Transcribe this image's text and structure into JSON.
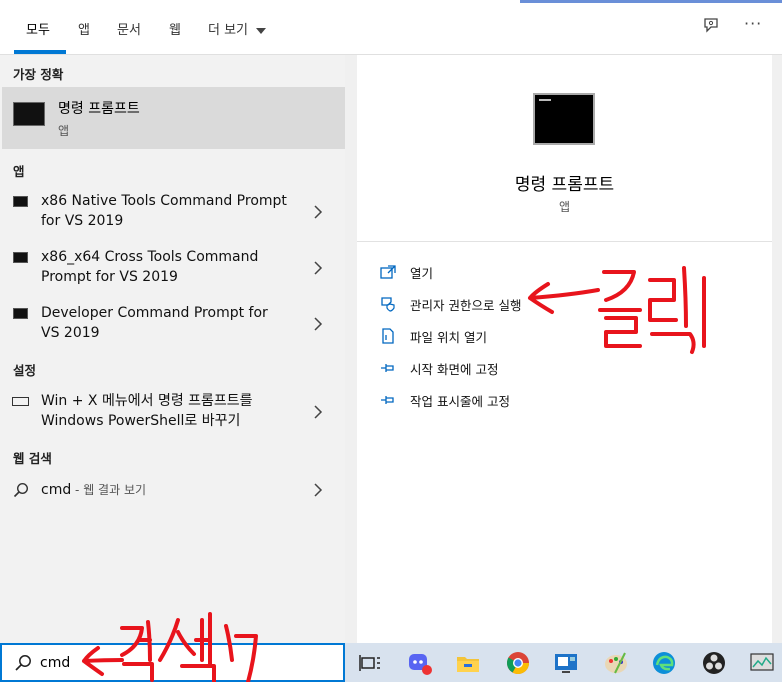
{
  "tabs": [
    {
      "label": "모두"
    },
    {
      "label": "앱"
    },
    {
      "label": "문서"
    },
    {
      "label": "웹"
    },
    {
      "label": "더 보기"
    }
  ],
  "sections": {
    "best_match": "가장 정확",
    "apps": "앱",
    "settings": "설정",
    "web": "웹 검색"
  },
  "best_match": {
    "title": "명령 프롬프트",
    "subtitle": "앱"
  },
  "apps": [
    {
      "line1": "x86 Native Tools Command Prompt",
      "line2": "for VS 2019"
    },
    {
      "line1": "x86_x64 Cross Tools Command",
      "line2": "Prompt for VS 2019"
    },
    {
      "line1": "Developer Command Prompt for",
      "line2": "VS 2019"
    }
  ],
  "settings": [
    {
      "line1": "Win + X 메뉴에서 명령 프롬프트를",
      "line2": "Windows PowerShell로 바꾸기"
    }
  ],
  "web": {
    "query": "cmd",
    "suffix": " - 웹 결과 보기"
  },
  "preview": {
    "title": "명령 프롬프트",
    "subtitle": "앱",
    "actions": [
      {
        "label": "열기",
        "icon": "open-icon"
      },
      {
        "label": "관리자 권한으로 실행",
        "icon": "shield-icon"
      },
      {
        "label": "파일 위치 열기",
        "icon": "file-location-icon"
      },
      {
        "label": "시작 화면에 고정",
        "icon": "pin-icon"
      },
      {
        "label": "작업 표시줄에 고정",
        "icon": "pin-icon"
      }
    ]
  },
  "search": {
    "value": "cmd"
  },
  "annotations": {
    "click": "클릭",
    "search": "검색"
  },
  "colors": {
    "accent": "#0078d4",
    "annotation": "#e8141c"
  }
}
